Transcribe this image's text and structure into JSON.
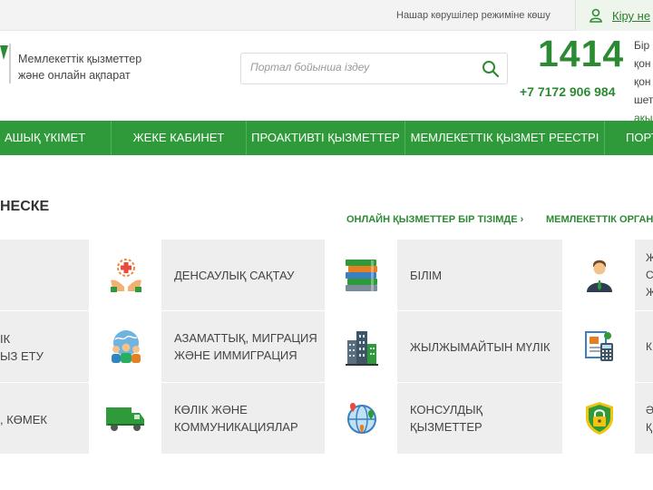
{
  "topbar": {
    "vision_mode": "Нашар көрушілер режиміне көшу",
    "login": "Кіру не"
  },
  "header": {
    "logo_line1": "Мемлекеттік қызметтер",
    "logo_line2": "және онлайн ақпарат",
    "search_placeholder": "Портал бойынша іздеу",
    "hotline_number": "1414",
    "phone": "+7 7172 906 984",
    "hotline_info": [
      "Бір",
      "қон",
      "қон",
      "шет"
    ],
    "hotline_link": "ақы"
  },
  "nav": {
    "items": [
      "АШЫҚ ҮКІМЕТ",
      "ЖЕКЕ КАБИНЕТ",
      "ПРОАКТИВТІ ҚЫЗМЕТТЕР",
      "МЕМЛЕКЕТТІК ҚЫЗМЕТ РЕЕСТРІ",
      "ПОРТ"
    ]
  },
  "section": {
    "title": "НЕСКЕ",
    "link_online": "ОНЛАЙН ҚЫЗМЕТТЕР БІР ТІЗІМДЕ ›",
    "link_org": "МЕМЛЕКЕТТІК ОРГАН"
  },
  "categories": {
    "left": [
      {
        "line1": "",
        "line2": ""
      },
      {
        "line1": "ІК",
        "line2": "ЫЗ ЕТУ"
      },
      {
        "line1": ", КӨМЕК",
        "line2": ""
      }
    ],
    "col1": [
      {
        "line1": "ДЕНСАУЛЫҚ САҚТАУ",
        "line2": "",
        "icon": "health-care-icon"
      },
      {
        "line1": "АЗАМАТТЫҚ, МИГРАЦИЯ",
        "line2": "ЖӘНЕ ИММИГРАЦИЯ",
        "icon": "migration-people-icon"
      },
      {
        "line1": "КӨЛІК ЖӘНЕ",
        "line2": "КОММУНИКАЦИЯЛАР",
        "icon": "truck-icon"
      }
    ],
    "col2": [
      {
        "line1": "БІЛІМ",
        "line2": "",
        "icon": "books-icon"
      },
      {
        "line1": "ЖЫЛЖЫМАЙТЫН МҮЛІК",
        "line2": "",
        "icon": "buildings-icon"
      },
      {
        "line1": "КОНСУЛДЫҚ",
        "line2": "ҚЫЗМЕТТЕР",
        "icon": "globe-pins-icon"
      }
    ],
    "right": [
      {
        "lines": [
          "Ж",
          "С",
          "Ж"
        ],
        "icon": "businessman-icon"
      },
      {
        "lines": [
          "К"
        ],
        "icon": "documents-calculator-icon"
      },
      {
        "lines": [
          "Ә",
          "Қ"
        ],
        "icon": "security-lock-icon"
      }
    ]
  },
  "colors": {
    "brand_green": "#2f9a3a",
    "text_green": "#2d8a34",
    "tile_grey": "#eeeeee"
  }
}
